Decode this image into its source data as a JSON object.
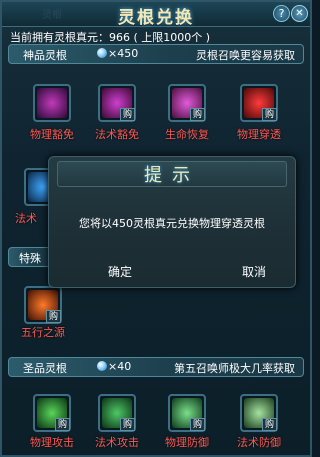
{
  "window": {
    "title": "灵根兑换",
    "ghost_text": "灵根",
    "help_label": "?",
    "close_label": "✕"
  },
  "holdings": {
    "text": "当前拥有灵根真元：966 ( 上限1000个 )"
  },
  "sections": {
    "divine": {
      "name": "神品灵根",
      "cost": "×450",
      "tip": "灵根召唤更容易获取",
      "items": [
        {
          "label": "物理豁免",
          "buy": "购",
          "color1": "#c23ab8",
          "color2": "#2b0a3a"
        },
        {
          "label": "法术豁免",
          "buy": "购",
          "color1": "#cf3fcf",
          "color2": "#3b0a34"
        },
        {
          "label": "生命恢复",
          "buy": "购",
          "color1": "#e25bd9",
          "color2": "#4a1040"
        },
        {
          "label": "物理穿透",
          "buy": "购",
          "color1": "#ff3b3b",
          "color2": "#4b0909"
        }
      ]
    },
    "special": {
      "name": "特殊",
      "items": [
        {
          "label": "法术",
          "color1": "#3fa9ff",
          "color2": "#0a2546"
        },
        {
          "label": "五行之源",
          "buy": "购",
          "color1": "#ff7a2a",
          "color2": "#3d1004"
        }
      ]
    },
    "sacred": {
      "name": "圣品灵根",
      "cost": "×40",
      "tip": "第五召唤师极大几率获取",
      "items": [
        {
          "label": "物理攻击",
          "buy": "购",
          "color1": "#59d65a",
          "color2": "#0a3312"
        },
        {
          "label": "法术攻击",
          "buy": "购",
          "color1": "#4ec866",
          "color2": "#0b3216"
        },
        {
          "label": "物理防御",
          "buy": "购",
          "color1": "#7be08a",
          "color2": "#0c3a1c"
        },
        {
          "label": "法术防御",
          "buy": "购",
          "color1": "#a6e3a0",
          "color2": "#173a1d"
        }
      ]
    }
  },
  "dialog": {
    "title": "提示",
    "message": "您将以450灵根真元兑换物理穿透灵根",
    "confirm": "确定",
    "cancel": "取消"
  },
  "colors": {
    "label_red": "#ff5a55",
    "title_gold": "#f6e7b3",
    "panel_bg": "#0f2430"
  }
}
